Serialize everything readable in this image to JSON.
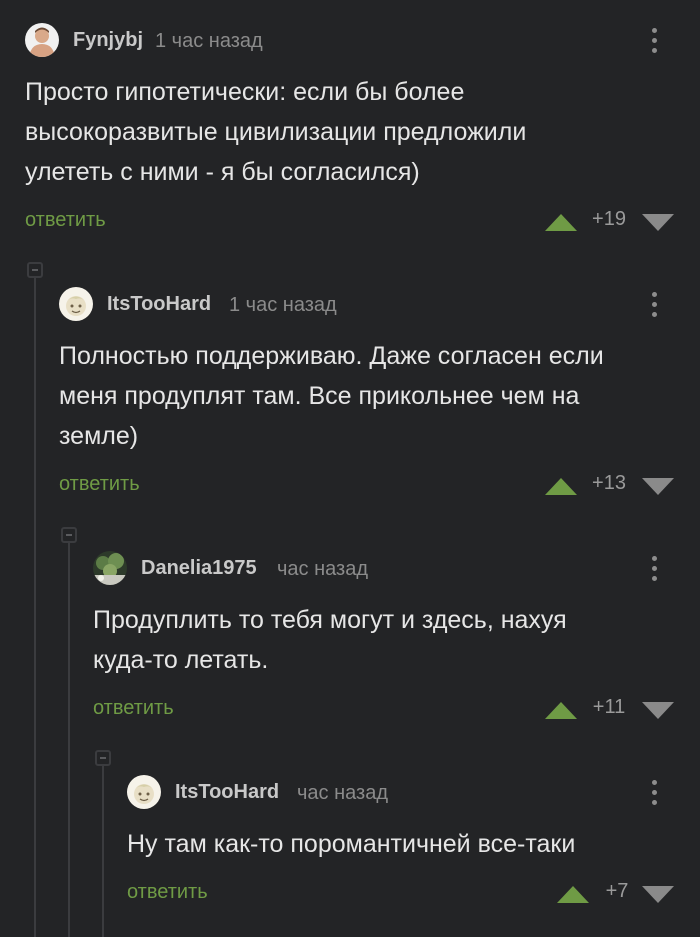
{
  "colors": {
    "background": "#232426",
    "accent_green": "#6f9b45",
    "text": "#e6e6e6",
    "muted": "#8b8b8b"
  },
  "comments": [
    {
      "author": "Fynjybj",
      "time": "1 час назад",
      "lines": [
        "Просто гипотетически: если бы более",
        "высокоразвитые цивилизации предложили",
        "улететь с ними - я бы согласился)"
      ],
      "reply_label": "ответить",
      "score": "+19",
      "avatar_icon": "user-photo-avatar"
    },
    {
      "author": "ItsTooHard",
      "time": "1 час назад",
      "lines": [
        "Полностью поддерживаю. Даже согласен если",
        "меня продуплят там. Все прикольнее чем на",
        "земле)"
      ],
      "reply_label": "ответить",
      "score": "+13",
      "avatar_icon": "cartoon-avatar"
    },
    {
      "author": "Danelia1975",
      "time": "час назад",
      "lines": [
        "Продуплить то тебя могут и здесь, нахуя",
        "куда-то летать."
      ],
      "reply_label": "ответить",
      "score": "+11",
      "avatar_icon": "landscape-avatar"
    },
    {
      "author": "ItsTooHard",
      "time": "час назад",
      "lines": [
        "Ну там как-то поромантичней все-таки"
      ],
      "reply_label": "ответить",
      "score": "+7",
      "avatar_icon": "cartoon-avatar"
    }
  ]
}
